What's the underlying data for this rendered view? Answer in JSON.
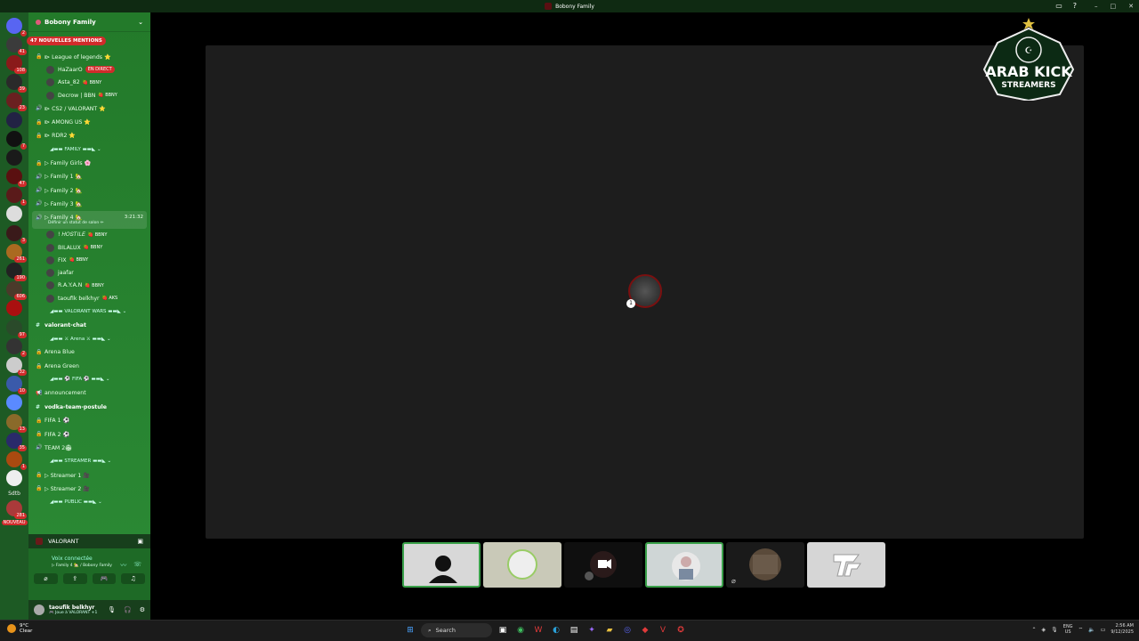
{
  "window": {
    "title": "Bobony Family",
    "controls": [
      "–",
      "□",
      "✕"
    ]
  },
  "rail": {
    "badges": [
      "2",
      "41",
      "108",
      "39",
      "23",
      "",
      "7",
      "",
      "47",
      "1",
      "",
      "3",
      "261",
      "190",
      "606",
      "",
      "97",
      "2",
      "32",
      "10",
      "",
      "13",
      "35",
      "1",
      "",
      "281"
    ],
    "sdtb_label": "Sdtb",
    "new_label": "NOUVEAU"
  },
  "sidebar": {
    "server_name": "Bobony Family",
    "mentions": "47 NOUVELLES MENTIONS",
    "rows": [
      {
        "kind": "chan",
        "icon": "🔒",
        "text": "⧐ League of legends ⭐"
      },
      {
        "kind": "user",
        "text": "HaZaarO",
        "tag": "",
        "pill": "EN DIRECT"
      },
      {
        "kind": "user",
        "text": "Asta_82",
        "tag": "🍓 BBNY",
        "pill": ""
      },
      {
        "kind": "user",
        "text": "Decrow | BBN",
        "tag": "🍓 BBNY",
        "pill": ""
      },
      {
        "kind": "chan",
        "icon": "🔊",
        "text": "⧐ CS2 / VALORANT ⭐"
      },
      {
        "kind": "chan",
        "icon": "🔒",
        "text": "⧐ AMONG US ⭐"
      },
      {
        "kind": "chan",
        "icon": "🔒",
        "text": "⧐ RDR2 ⭐"
      },
      {
        "kind": "cat",
        "text": "◢▬▬ FAMILY ▬▬◣ ⌄"
      },
      {
        "kind": "chan",
        "icon": "🔒",
        "text": "▷ Family Girls 🌸"
      },
      {
        "kind": "chan",
        "icon": "🔊",
        "text": "▷ Family 1 🏡"
      },
      {
        "kind": "chan",
        "icon": "🔊",
        "text": "▷ Family 2 🏡"
      },
      {
        "kind": "chan",
        "icon": "🔊",
        "text": "▷ Family 3 🏡"
      },
      {
        "kind": "active",
        "icon": "🔊",
        "text": "▷ Family 4 🏡",
        "time": "3:21:32",
        "sub": "Définir un statut de salon ✏"
      },
      {
        "kind": "user",
        "text": "! 𝐻𝑂𝑆𝑇𝐼𝐿𝐸",
        "tag": "🍓 BBNY",
        "pill": ""
      },
      {
        "kind": "user",
        "text": "BILALUX",
        "tag": "🍓 BBNY",
        "pill": ""
      },
      {
        "kind": "user",
        "text": "FIX",
        "tag": "🍓 BBNY",
        "pill": ""
      },
      {
        "kind": "user",
        "text": "jaafar",
        "tag": "",
        "pill": ""
      },
      {
        "kind": "user",
        "text": "R.A.Y.A.N",
        "tag": "🍓 BBNY",
        "pill": ""
      },
      {
        "kind": "user",
        "text": "taoufik belkhyr",
        "tag": "🍓 AKS",
        "pill": ""
      },
      {
        "kind": "cat",
        "text": "◢▬▬ VALORANT WARS ▬▬◣ ⌄"
      },
      {
        "kind": "text",
        "icon": "#",
        "text": "valorant-chat"
      },
      {
        "kind": "cat",
        "text": "◢▬▬ ⚔ Arena ⚔ ▬▬◣ ⌄"
      },
      {
        "kind": "chan",
        "icon": "🔒",
        "text": "Arena Blue"
      },
      {
        "kind": "chan",
        "icon": "🔒",
        "text": "Arena Green"
      },
      {
        "kind": "cat",
        "text": "◢▬▬ ⚽ FIFA ⚽ ▬▬◣ ⌄"
      },
      {
        "kind": "chan",
        "icon": "📢",
        "text": "announcement"
      },
      {
        "kind": "text",
        "icon": "#",
        "text": "vodka-team-postule"
      },
      {
        "kind": "chan",
        "icon": "🔒",
        "text": "FIFA 1 ⚽"
      },
      {
        "kind": "chan",
        "icon": "🔒",
        "text": "FIFA 2 ⚽"
      },
      {
        "kind": "chan",
        "icon": "🔊",
        "text": "TEAM 2🏟"
      },
      {
        "kind": "cat",
        "text": "◢▬▬ STREAMER ▬▬◣ ⌄"
      },
      {
        "kind": "chan",
        "icon": "🔒",
        "text": "▷ Streamer 1 🎥"
      },
      {
        "kind": "chan",
        "icon": "🔒",
        "text": "▷ Streamer 2 🎥"
      },
      {
        "kind": "cat",
        "text": "◢▬▬ PUBLIC ▬▬◣ ⌄"
      }
    ]
  },
  "voice": {
    "activity": "VALORANT",
    "status": "Voix connectée",
    "channel": "▷ Family 4 🏡 / Bobony Family"
  },
  "user": {
    "name": "taoufik belkhyr",
    "status": "🎮 Joue à VALORANT +1"
  },
  "logo": {
    "line1": "ARAB KICK",
    "line2": "STREAMERS"
  },
  "taskbar": {
    "temp": "9°C",
    "weather": "Clear",
    "search_placeholder": "Search",
    "lang1": "ENG",
    "lang2": "US",
    "time": "2:56 AM",
    "date": "9/12/2025"
  },
  "colors": {
    "accent": "#2b8a35",
    "live": "#d12b2b"
  }
}
